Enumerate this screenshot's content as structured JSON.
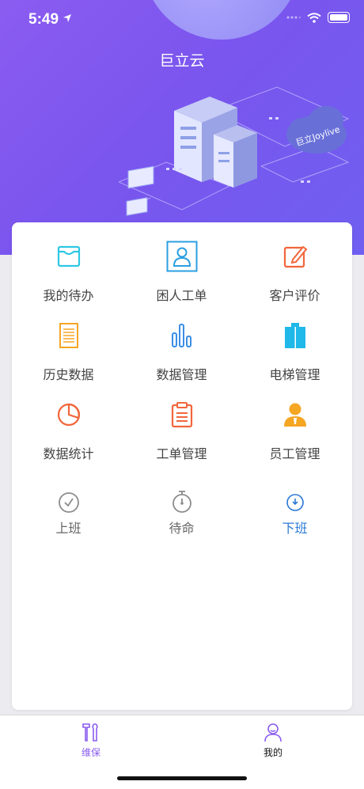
{
  "status_bar": {
    "time": "5:49"
  },
  "header": {
    "title": "巨立云"
  },
  "banner": {
    "cloud_text": "巨立Joylive"
  },
  "menu": {
    "items": [
      {
        "label": "我的待办",
        "icon": "inbox-icon",
        "color": "#2ec7e6"
      },
      {
        "label": "困人工单",
        "icon": "person-icon",
        "color": "#2b9fe0"
      },
      {
        "label": "客户评价",
        "icon": "edit-icon",
        "color": "#f2663b"
      },
      {
        "label": "历史数据",
        "icon": "document-icon",
        "color": "#f5a623"
      },
      {
        "label": "数据管理",
        "icon": "bar-chart-icon",
        "color": "#3a8ee6"
      },
      {
        "label": "电梯管理",
        "icon": "elevator-icon",
        "color": "#1fb8e8"
      },
      {
        "label": "数据统计",
        "icon": "pie-chart-icon",
        "color": "#f2663b"
      },
      {
        "label": "工单管理",
        "icon": "clipboard-icon",
        "color": "#f2663b"
      },
      {
        "label": "员工管理",
        "icon": "staff-icon",
        "color": "#f5a623"
      }
    ]
  },
  "shift": {
    "items": [
      {
        "label": "上班",
        "icon": "check-circle-icon",
        "color": "#666666"
      },
      {
        "label": "待命",
        "icon": "stopwatch-icon",
        "color": "#666666"
      },
      {
        "label": "下班",
        "icon": "clock-down-icon",
        "color": "#2b78d6"
      }
    ]
  },
  "tabbar": {
    "tabs": [
      {
        "label": "维保",
        "icon": "tools-icon",
        "active": true,
        "color": "#8a5cf0"
      },
      {
        "label": "我的",
        "icon": "user-icon",
        "active": false,
        "color": "#111111"
      }
    ]
  }
}
